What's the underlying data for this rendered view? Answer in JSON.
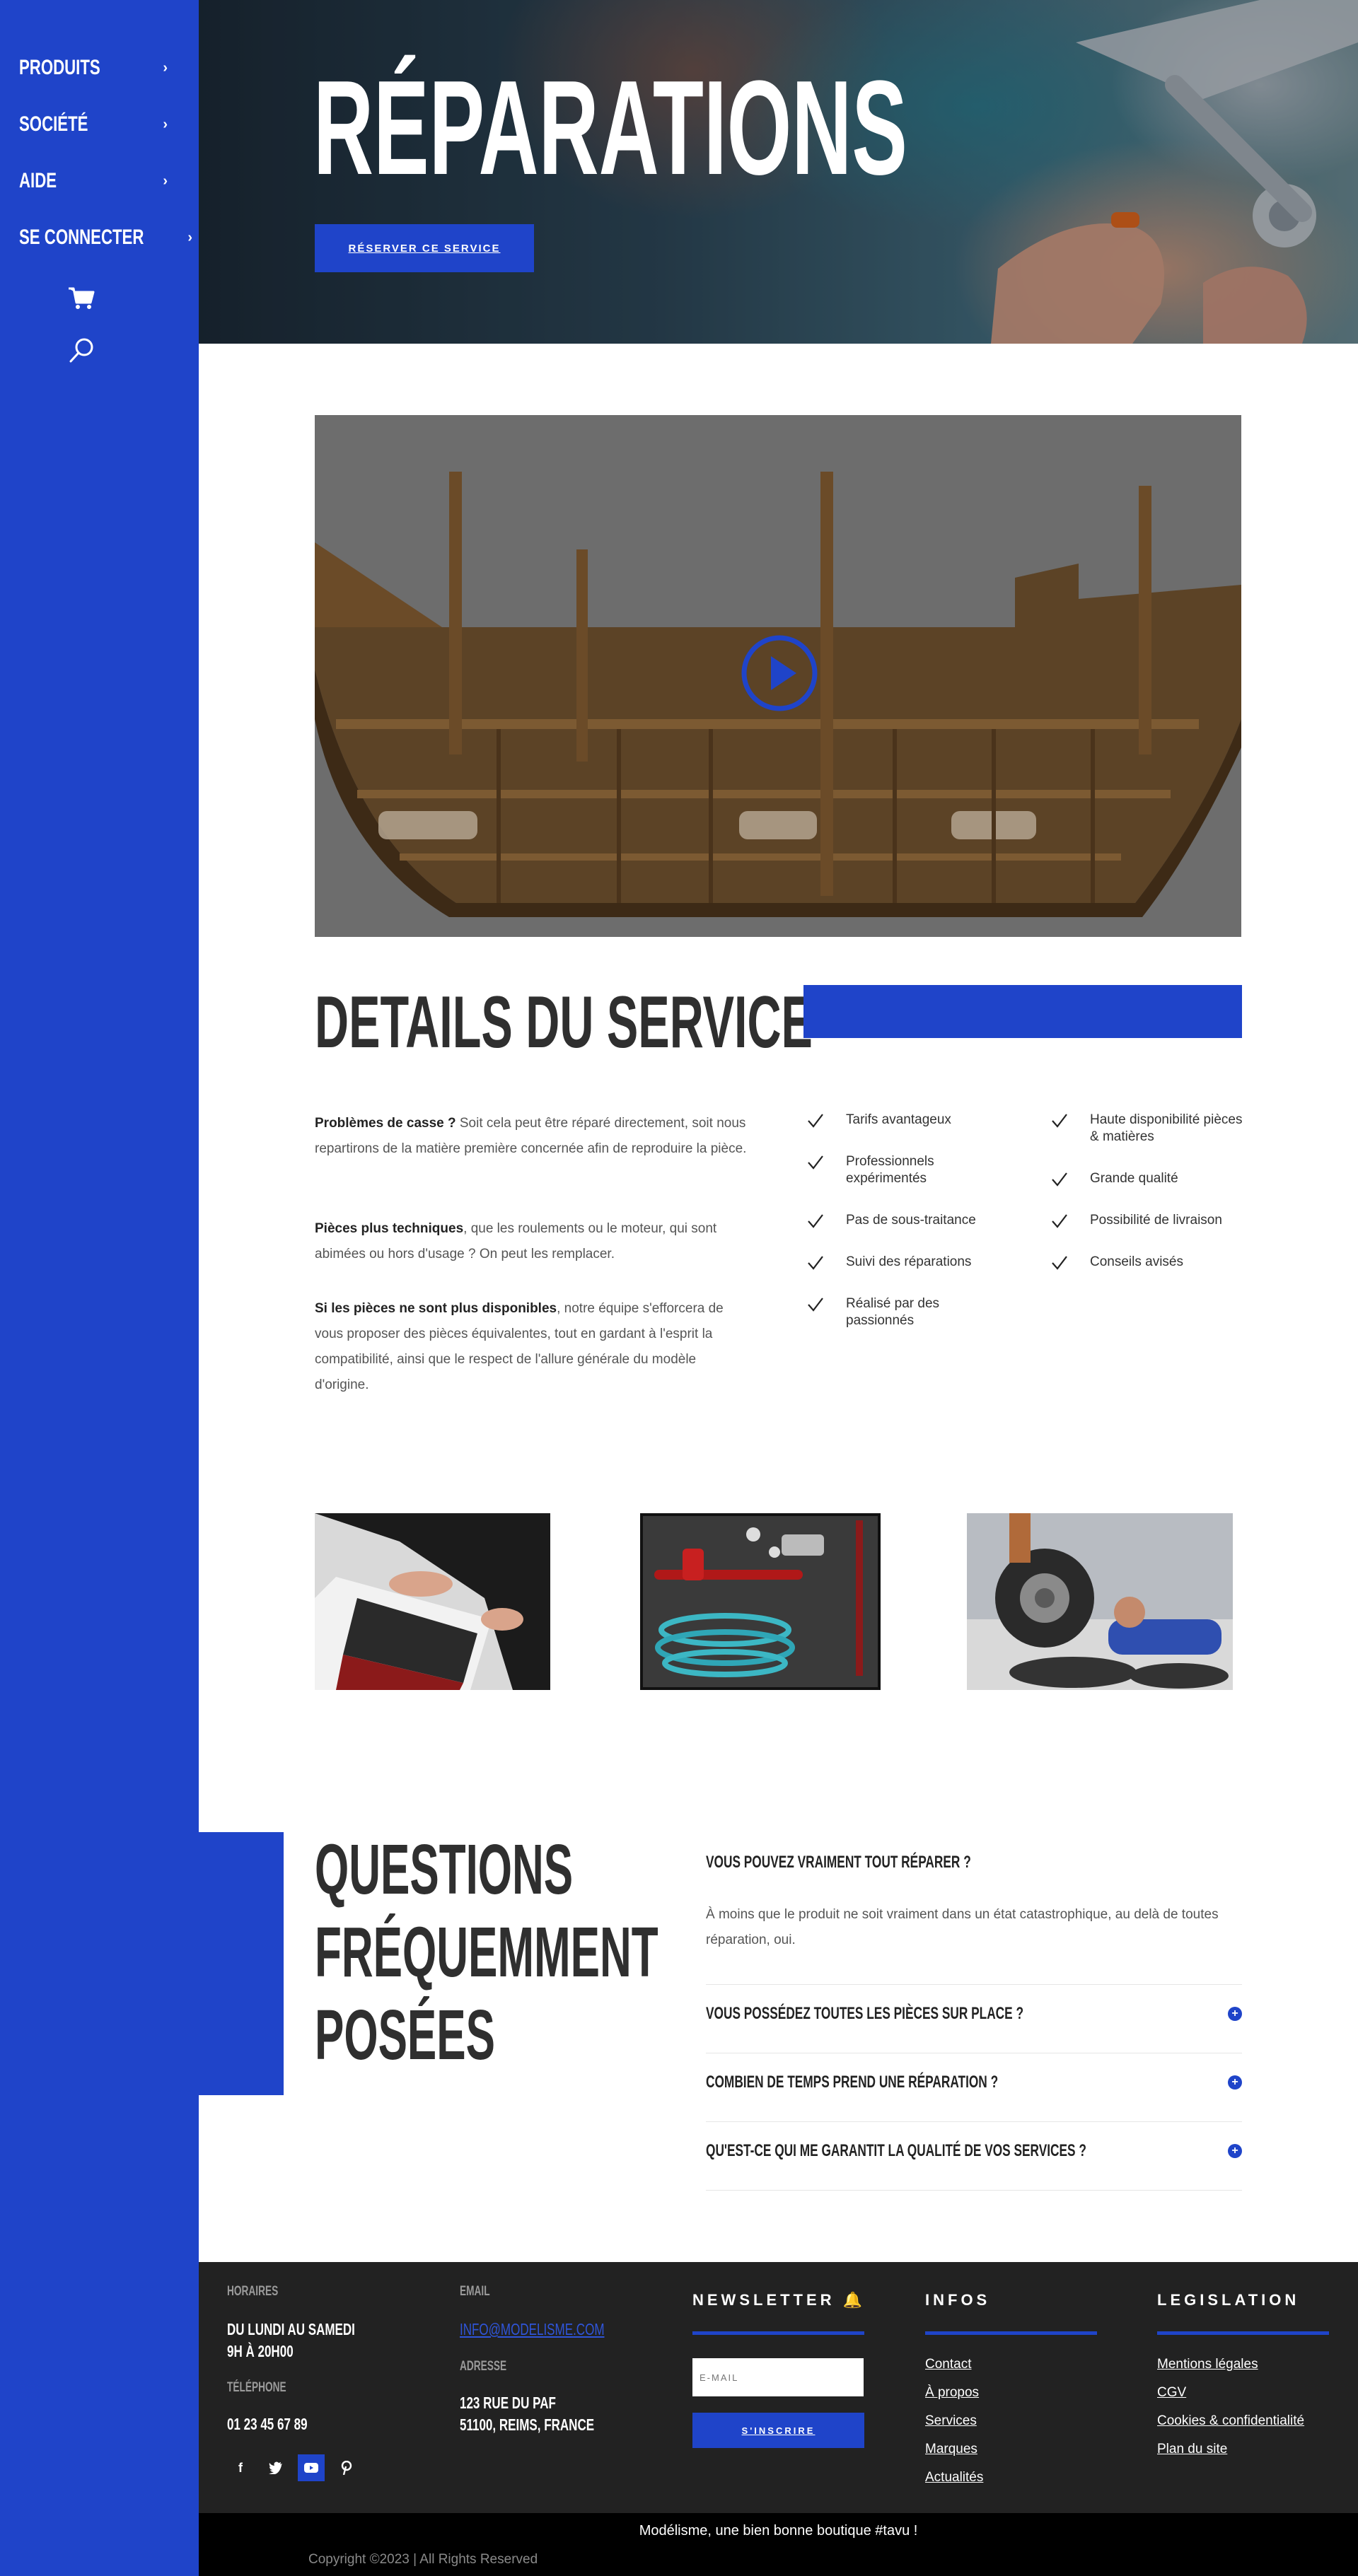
{
  "sidebar": {
    "items": [
      {
        "label": "PRODUITS"
      },
      {
        "label": "SOCIÉTÉ"
      },
      {
        "label": "AIDE"
      },
      {
        "label": "SE CONNECTER"
      }
    ],
    "chevron": "›",
    "icons": [
      "cart-icon",
      "search-icon"
    ]
  },
  "hero": {
    "title": "RÉPARATIONS",
    "button_label": "RÉSERVER CE SERVICE"
  },
  "video": {
    "icon": "play-icon"
  },
  "details": {
    "title": "DETAILS DU SERVICE",
    "paragraphs": [
      {
        "bold": "Problèmes de casse ?",
        "text": " Soit cela peut être réparé directement, soit nous repartirons de la matière première concernée afin de reproduire la pièce."
      },
      {
        "bold": "Pièces plus techniques",
        "text": ", que les roulements ou le moteur, qui sont abimées ou hors d'usage ? On peut les remplacer."
      },
      {
        "bold": "Si les pièces ne sont plus disponibles",
        "text": ", notre équipe s'efforcera de vous proposer des pièces équivalentes, tout en gardant à l'esprit la compatibilité, ainsi que le respect de l'allure générale du modèle d'origine."
      }
    ],
    "features_left": [
      "Tarifs avantageux",
      "Professionnels expérimentés",
      "Pas de sous-traitance",
      "Suivi des réparations",
      "Réalisé par des passionnés"
    ],
    "features_right": [
      "Haute disponibilité pièces & matières",
      "Grande qualité",
      "Possibilité de livraison",
      "Conseils avisés"
    ]
  },
  "faq": {
    "title_lines": [
      "QUESTIONS",
      "FRÉQUEMMENT",
      "POSÉES"
    ],
    "open_question": "VOUS POUVEZ VRAIMENT TOUT RÉPARER ?",
    "open_answer": "À moins que le produit ne soit vraiment dans un état catastrophique, au delà de toutes réparation, oui.",
    "questions": [
      "VOUS POSSÉDEZ TOUTES LES PIÈCES SUR PLACE ?",
      "COMBIEN DE TEMPS PREND UNE RÉPARATION ?",
      "QU'EST-CE QUI ME GARANTIT LA QUALITÉ DE VOS SERVICES ?"
    ]
  },
  "footer": {
    "hours_label": "HORAIRES",
    "hours_line1": "DU LUNDI AU SAMEDI",
    "hours_line2": "9H À 20H00",
    "phone_label": "TÉLÉPHONE",
    "phone": "01 23 45 67 89",
    "email_label": "EMAIL",
    "email": "INFO@MODELISME.COM",
    "address_label": "ADRESSE",
    "address_line1": "123 RUE DU PAF",
    "address_line2": "51100, REIMS, FRANCE",
    "newsletter_title": "NEWSLETTER 🔔",
    "email_placeholder": "E-MAIL",
    "subscribe_label": "S'INSCRIRE",
    "infos_title": "INFOS",
    "infos_links": [
      "Contact",
      "À propos",
      "Services",
      "Marques",
      "Actualités"
    ],
    "legal_title": "LEGISLATION",
    "legal_links": [
      "Mentions légales",
      "CGV",
      "Cookies & confidentialité",
      "Plan du site"
    ],
    "social": [
      "facebook-icon",
      "twitter-icon",
      "youtube-icon",
      "pinterest-icon"
    ],
    "tagline": "Modélisme, une bien bonne boutique #tavu !",
    "copyright": "Copyright ©2023 | All Rights Reserved"
  },
  "colors": {
    "brand_blue": "#1f44c9",
    "footer_bg": "#222222",
    "heading": "#2f2f2f"
  }
}
